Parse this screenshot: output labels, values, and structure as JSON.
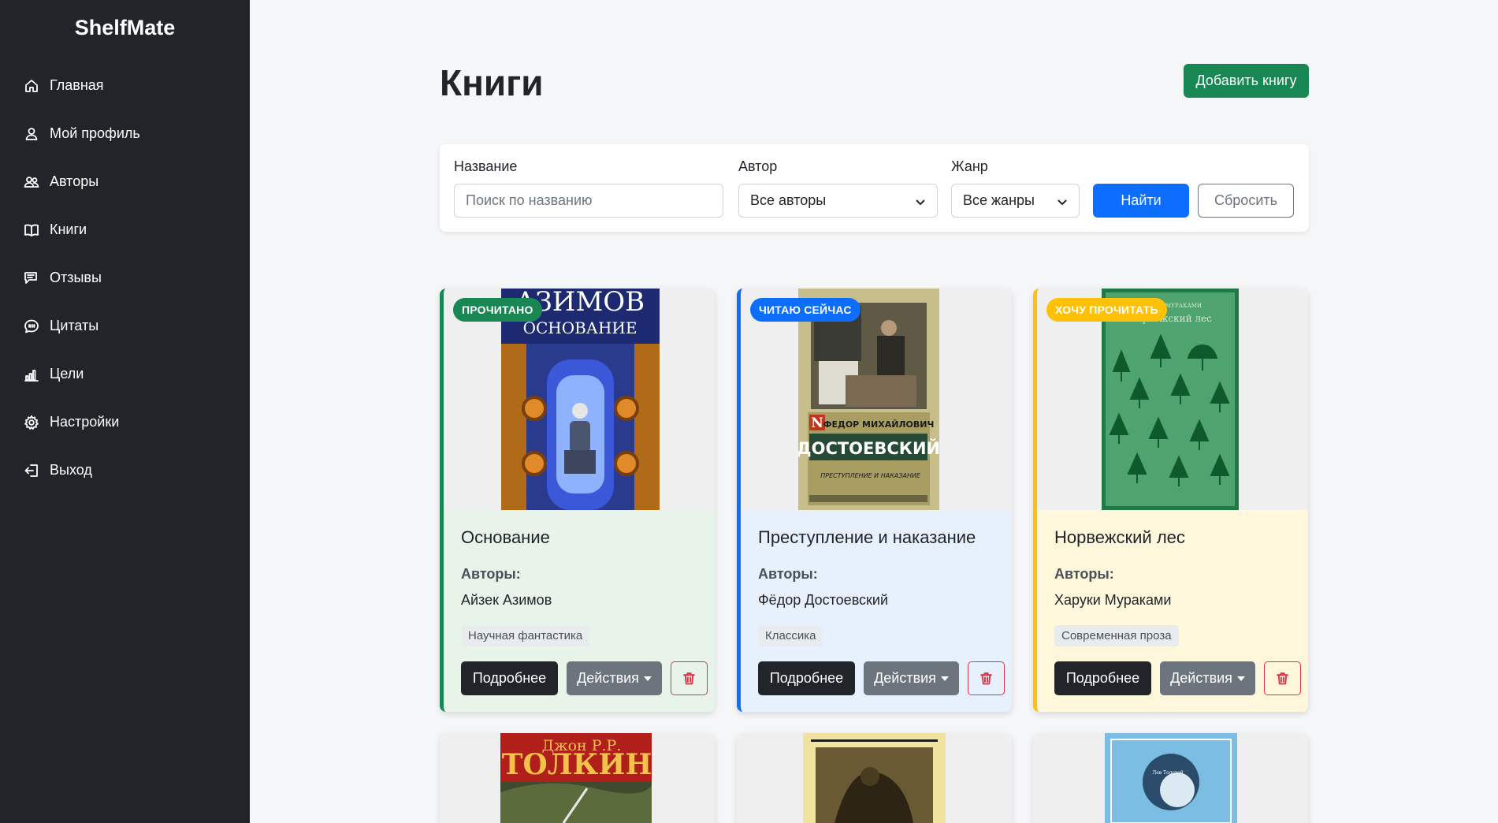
{
  "app": {
    "brand": "ShelfMate"
  },
  "sidebar": {
    "items": [
      {
        "label": "Главная",
        "icon": "home-icon"
      },
      {
        "label": "Мой профиль",
        "icon": "user-icon"
      },
      {
        "label": "Авторы",
        "icon": "users-icon"
      },
      {
        "label": "Книги",
        "icon": "book-icon"
      },
      {
        "label": "Отзывы",
        "icon": "reviews-icon"
      },
      {
        "label": "Цитаты",
        "icon": "quote-icon"
      },
      {
        "label": "Цели",
        "icon": "bar-chart-icon"
      },
      {
        "label": "Настройки",
        "icon": "gear-icon"
      },
      {
        "label": "Выход",
        "icon": "logout-icon"
      }
    ]
  },
  "header": {
    "title": "Книги",
    "add_label": "Добавить книгу"
  },
  "filters": {
    "title_label": "Название",
    "title_placeholder": "Поиск по названию",
    "author_label": "Автор",
    "author_value": "Все авторы",
    "genre_label": "Жанр",
    "genre_value": "Все жанры",
    "find_label": "Найти",
    "reset_label": "Сбросить"
  },
  "labels": {
    "authors": "Авторы:",
    "details": "Подробнее",
    "actions": "Действия"
  },
  "books": [
    {
      "status": "ПРОЧИТАНО",
      "status_color": "#198754",
      "status_text_color": "#ffffff",
      "accent": "#198754",
      "body_bg": "#e8f3ea",
      "cover_texts": [
        "АЗИМОВ",
        "ОСНОВАНИЕ"
      ],
      "title": "Основание",
      "author": "Айзек Азимов",
      "genre": "Научная фантастика"
    },
    {
      "status": "ЧИТАЮ СЕЙЧАС",
      "status_color": "#0d6efd",
      "status_text_color": "#ffffff",
      "accent": "#0d6efd",
      "body_bg": "#e7f0fd",
      "cover_texts": [
        "N",
        "ФЕДОР МИХАЙЛОВИЧ",
        "ДОСТОЕВСКИЙ",
        "ПРЕСТУПЛЕНИЕ И НАКАЗАНИЕ"
      ],
      "title": "Преступление и наказание",
      "author": "Фёдор Достоевский",
      "genre": "Классика"
    },
    {
      "status": "ХОЧУ ПРОЧИТАТЬ",
      "status_color": "#ffc107",
      "status_text_color": "#ffffff",
      "accent": "#ffc107",
      "body_bg": "#fff7dc",
      "cover_texts": [
        "ХАРУКИ МУРАКАМИ",
        "Норвежский лес"
      ],
      "title": "Норвежский лес",
      "author": "Харуки Мураками",
      "genre": "Современная проза"
    }
  ],
  "more_covers": [
    {
      "texts": [
        "Джон Р.Р.",
        "ТОЛКИН"
      ]
    },
    {
      "texts": []
    },
    {
      "texts": [
        "Лев Толстой"
      ]
    }
  ]
}
